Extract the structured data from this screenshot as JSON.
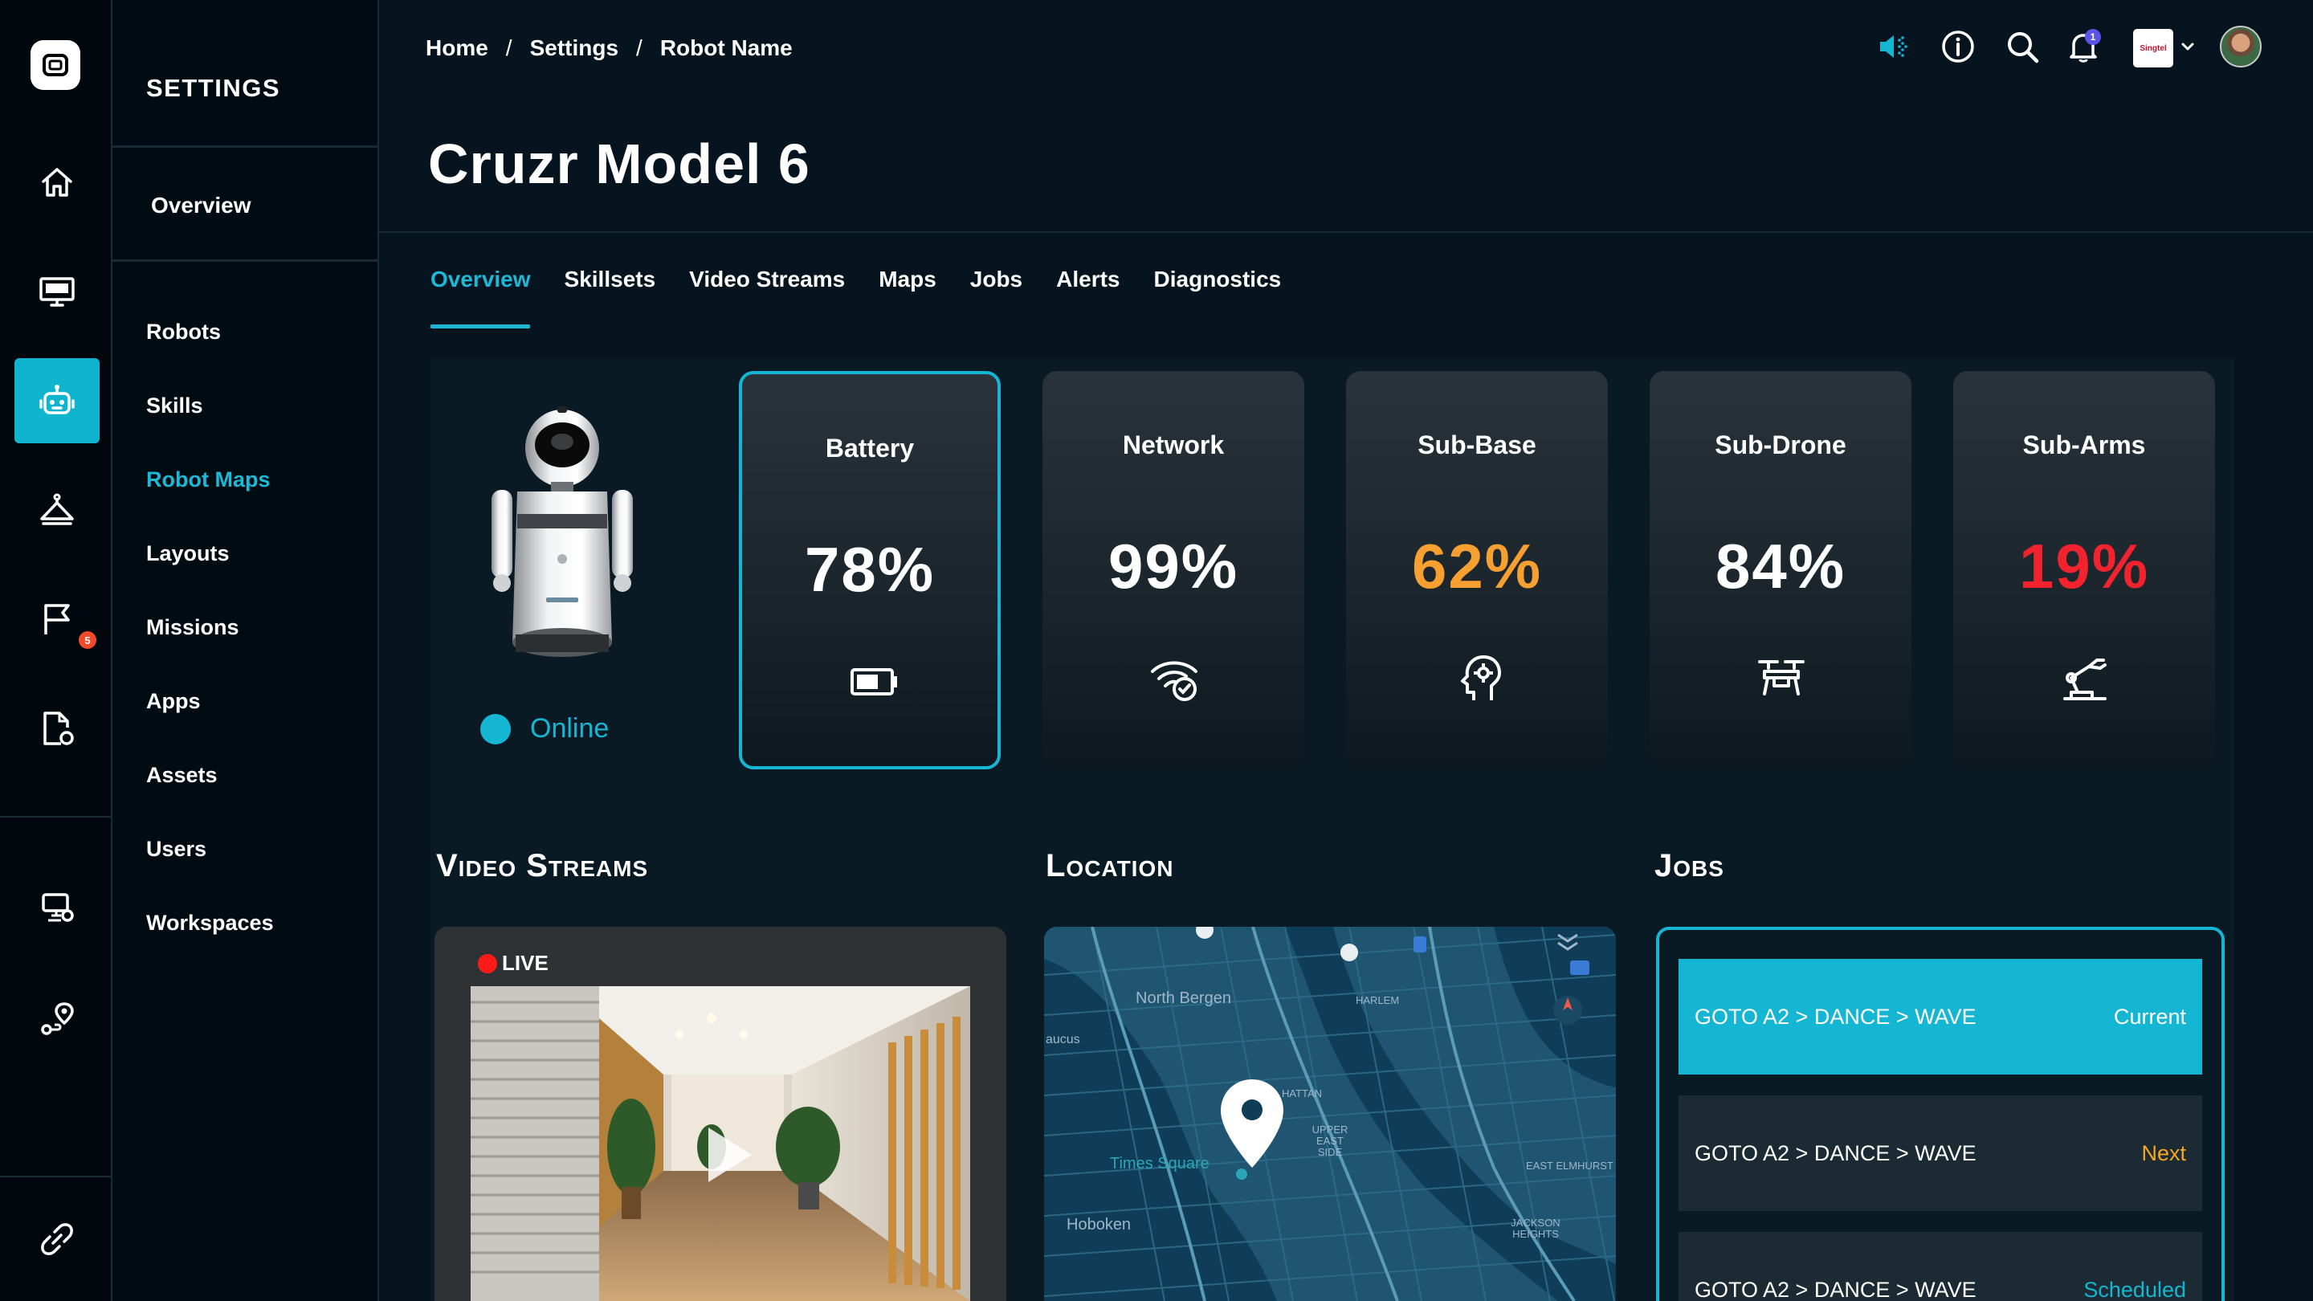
{
  "sidebar_rail": {
    "icons": [
      "logo-icon",
      "home-icon",
      "monitor-icon",
      "robot-icon",
      "hanger-icon",
      "flag-icon",
      "document-icon",
      "network-icon",
      "route-icon",
      "link-icon"
    ],
    "flag_badge": "5",
    "accent_color": "#0fb4cf"
  },
  "settings_panel": {
    "title": "SETTINGS",
    "overview": "Overview",
    "items": [
      {
        "label": "Robots",
        "active": false
      },
      {
        "label": "Skills",
        "active": false
      },
      {
        "label": "Robot Maps",
        "active": true
      },
      {
        "label": "Layouts",
        "active": false
      },
      {
        "label": "Missions",
        "active": false
      },
      {
        "label": "Apps",
        "active": false
      },
      {
        "label": "Assets",
        "active": false
      },
      {
        "label": "Users",
        "active": false
      },
      {
        "label": "Workspaces",
        "active": false
      }
    ]
  },
  "breadcrumb": {
    "items": [
      "Home",
      "Settings",
      "Robot Name"
    ],
    "separator": "/"
  },
  "header": {
    "notification_count": "1",
    "brand_text": "Singtel"
  },
  "page": {
    "title": "Cruzr Model 6"
  },
  "tabs": [
    {
      "label": "Overview",
      "active": true
    },
    {
      "label": "Skillsets",
      "active": false
    },
    {
      "label": "Video Streams",
      "active": false
    },
    {
      "label": "Maps",
      "active": false
    },
    {
      "label": "Jobs",
      "active": false
    },
    {
      "label": "Alerts",
      "active": false
    },
    {
      "label": "Diagnostics",
      "active": false
    }
  ],
  "robot": {
    "status": "Online",
    "status_color": "#14b6d4"
  },
  "metrics": [
    {
      "label": "Battery",
      "value": "78%",
      "color": "#ffffff",
      "icon": "battery-icon",
      "selected": true
    },
    {
      "label": "Network",
      "value": "99%",
      "color": "#ffffff",
      "icon": "wifi-check-icon",
      "selected": false
    },
    {
      "label": "Sub-Base",
      "value": "62%",
      "color": "#f5a030",
      "icon": "head-gear-icon",
      "selected": false
    },
    {
      "label": "Sub-Drone",
      "value": "84%",
      "color": "#ffffff",
      "icon": "drone-icon",
      "selected": false
    },
    {
      "label": "Sub-Arms",
      "value": "19%",
      "color": "#f0232f",
      "icon": "robot-arm-icon",
      "selected": false
    }
  ],
  "sections": {
    "video": "Video Streams",
    "location": "Location",
    "jobs": "Jobs"
  },
  "video": {
    "live_label": "LIVE"
  },
  "map": {
    "labels": {
      "north_bergen": "North Bergen",
      "harlem": "HARLEM",
      "manhattan": "HATTAN",
      "upper_east": "UPPER EAST SIDE",
      "times_square": "Times Square",
      "hoboken": "Hoboken",
      "east_elmhurst": "EAST ELMHURST",
      "jackson_heights": "JACKSON HEIGHTS",
      "secaucus": "aucus"
    }
  },
  "jobs": [
    {
      "name": "GOTO A2 > DANCE > WAVE",
      "status": "Current"
    },
    {
      "name": "GOTO A2 > DANCE > WAVE",
      "status": "Next"
    },
    {
      "name": "GOTO A2 > DANCE > WAVE",
      "status": "Scheduled"
    }
  ]
}
